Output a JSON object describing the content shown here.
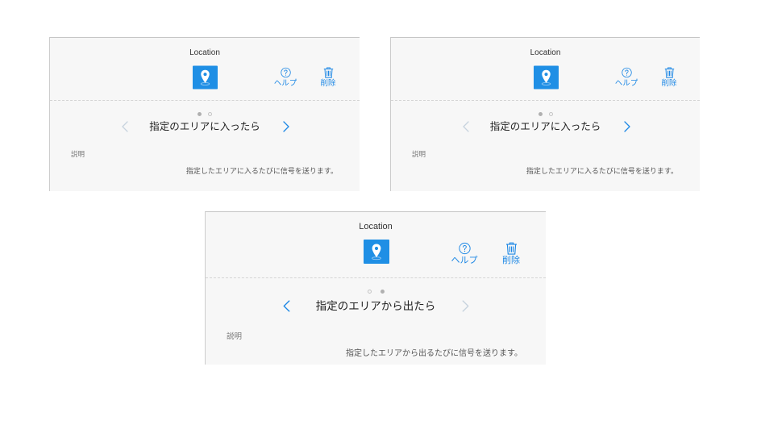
{
  "colors": {
    "page_background": "#ffffff",
    "panel_background": "#f7f7f7",
    "accent": "#1e88e5",
    "location_icon": "#1f8fe5",
    "disabled_chevron": "#c7d3de"
  },
  "panels": [
    {
      "title": "Location",
      "app_icon": "location-pin-icon",
      "toolbar": {
        "help_icon": "help-icon",
        "help_label": "ヘルプ",
        "delete_icon": "trash-icon",
        "delete_label": "削除"
      },
      "page_indicator": {
        "count": 2,
        "current": 1
      },
      "trigger": {
        "previous_icon": "chevron-left-icon",
        "previous_enabled": false,
        "title": "指定のエリアに入ったら",
        "next_icon": "chevron-right-icon",
        "next_enabled": true
      },
      "description": {
        "label": "説明",
        "text": "指定したエリアに入るたびに信号を送ります。"
      }
    },
    {
      "title": "Location",
      "app_icon": "location-pin-icon",
      "toolbar": {
        "help_icon": "help-icon",
        "help_label": "ヘルプ",
        "delete_icon": "trash-icon",
        "delete_label": "削除"
      },
      "page_indicator": {
        "count": 2,
        "current": 1
      },
      "trigger": {
        "previous_icon": "chevron-left-icon",
        "previous_enabled": false,
        "title": "指定のエリアに入ったら",
        "next_icon": "chevron-right-icon",
        "next_enabled": true
      },
      "description": {
        "label": "説明",
        "text": "指定したエリアに入るたびに信号を送ります。"
      }
    },
    {
      "title": "Location",
      "app_icon": "location-pin-icon",
      "toolbar": {
        "help_icon": "help-icon",
        "help_label": "ヘルプ",
        "delete_icon": "trash-icon",
        "delete_label": "削除"
      },
      "page_indicator": {
        "count": 2,
        "current": 2
      },
      "trigger": {
        "previous_icon": "chevron-left-icon",
        "previous_enabled": true,
        "title": "指定のエリアから出たら",
        "next_icon": "chevron-right-icon",
        "next_enabled": false
      },
      "description": {
        "label": "説明",
        "text": "指定したエリアから出るたびに信号を送ります。"
      }
    }
  ]
}
